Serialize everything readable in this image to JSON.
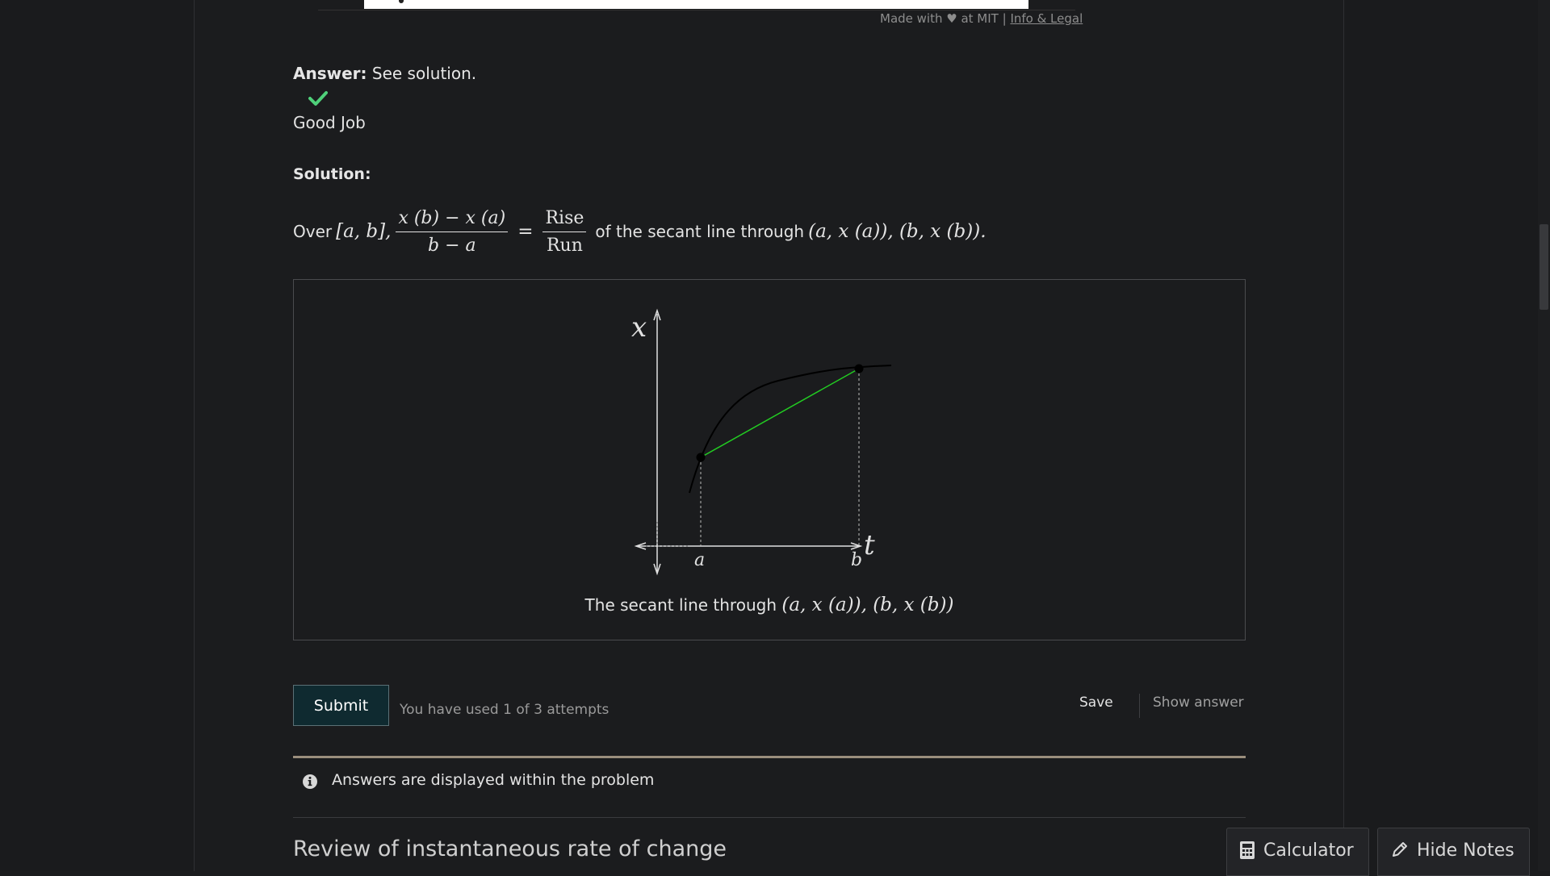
{
  "footer": {
    "made_with": "Made with ♥ at MIT |",
    "info_legal": "Info & Legal"
  },
  "answer": {
    "label": "Answer:",
    "text": "See solution.",
    "status_icon": "checkmark-icon",
    "status_color": "#4fd07a",
    "feedback": "Good Job"
  },
  "solution": {
    "label": "Solution:",
    "over": "Over",
    "interval": "[a, b],",
    "numerator": "x (b) − x (a)",
    "denominator": "b − a",
    "equals": "=",
    "rise": "Rise",
    "run": "Run",
    "middle_text": "of the secant line through",
    "points": "(a, x (a)), (b, x (b))."
  },
  "figure": {
    "axis_x_label": "x",
    "axis_t_label": "t",
    "tick_a": "a",
    "tick_b": "b",
    "secant_color": "#22cc22",
    "caption_text": "The secant line through",
    "caption_math": "(a, x (a)), (b, x (b))"
  },
  "controls": {
    "submit_label": "Submit",
    "attempts_text": "You have used 1 of 3 attempts",
    "save_label": "Save",
    "show_answer_label": "Show answer"
  },
  "notice": {
    "icon": "info-icon",
    "text": "Answers are displayed within the problem"
  },
  "next_section": {
    "heading": "Review of instantaneous rate of change"
  },
  "floating": {
    "calculator_label": "Calculator",
    "calculator_icon": "calculator-icon",
    "hide_notes_label": "Hide Notes",
    "hide_notes_icon": "pencil-icon"
  }
}
